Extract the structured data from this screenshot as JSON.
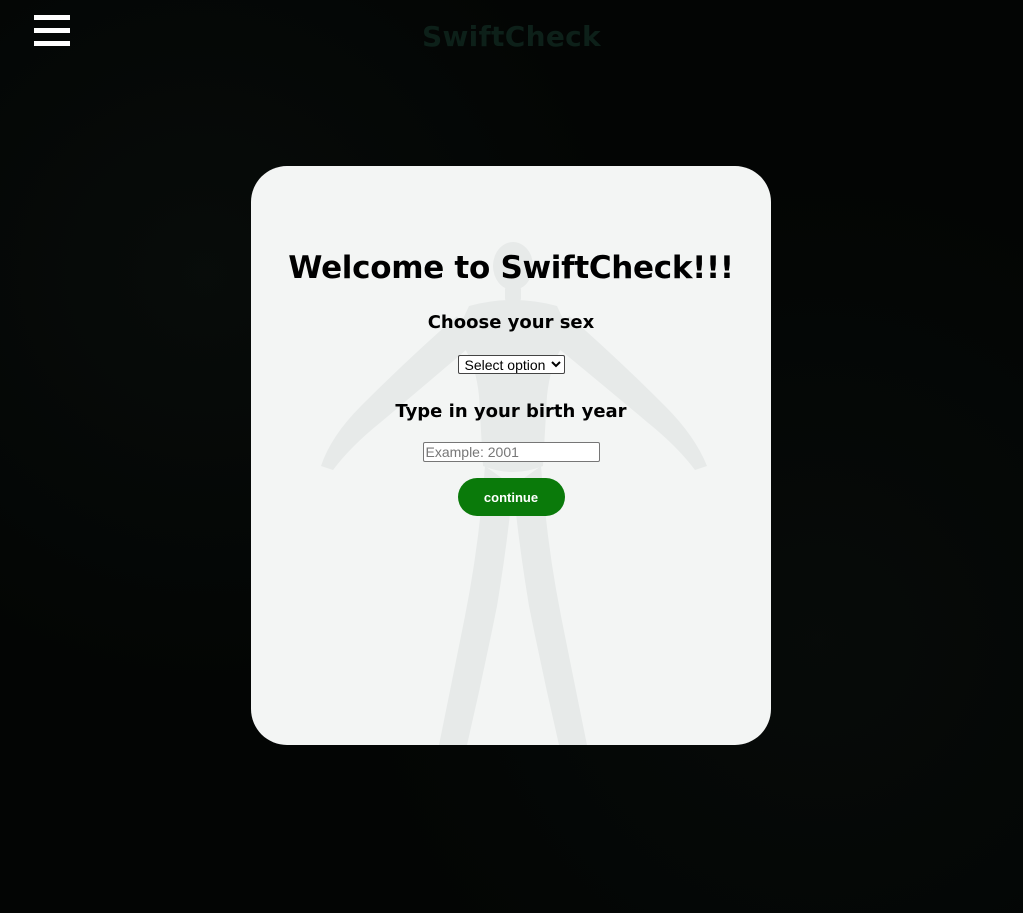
{
  "header": {
    "brand": "SwiftCheck",
    "menu_icon": "hamburger-menu-icon"
  },
  "card": {
    "title": "Welcome to SwiftCheck!!!",
    "sex_label": "Choose your sex",
    "sex_select": {
      "selected": "Select option",
      "options": [
        "Select option"
      ]
    },
    "year_label": "Type in your birth year",
    "year_input": {
      "value": "",
      "placeholder": "Example: 2001"
    },
    "continue_label": "continue"
  },
  "colors": {
    "background": "#030504",
    "card": "#f3f5f4",
    "button": "#0a7a0a",
    "brand": "#0d2019"
  }
}
